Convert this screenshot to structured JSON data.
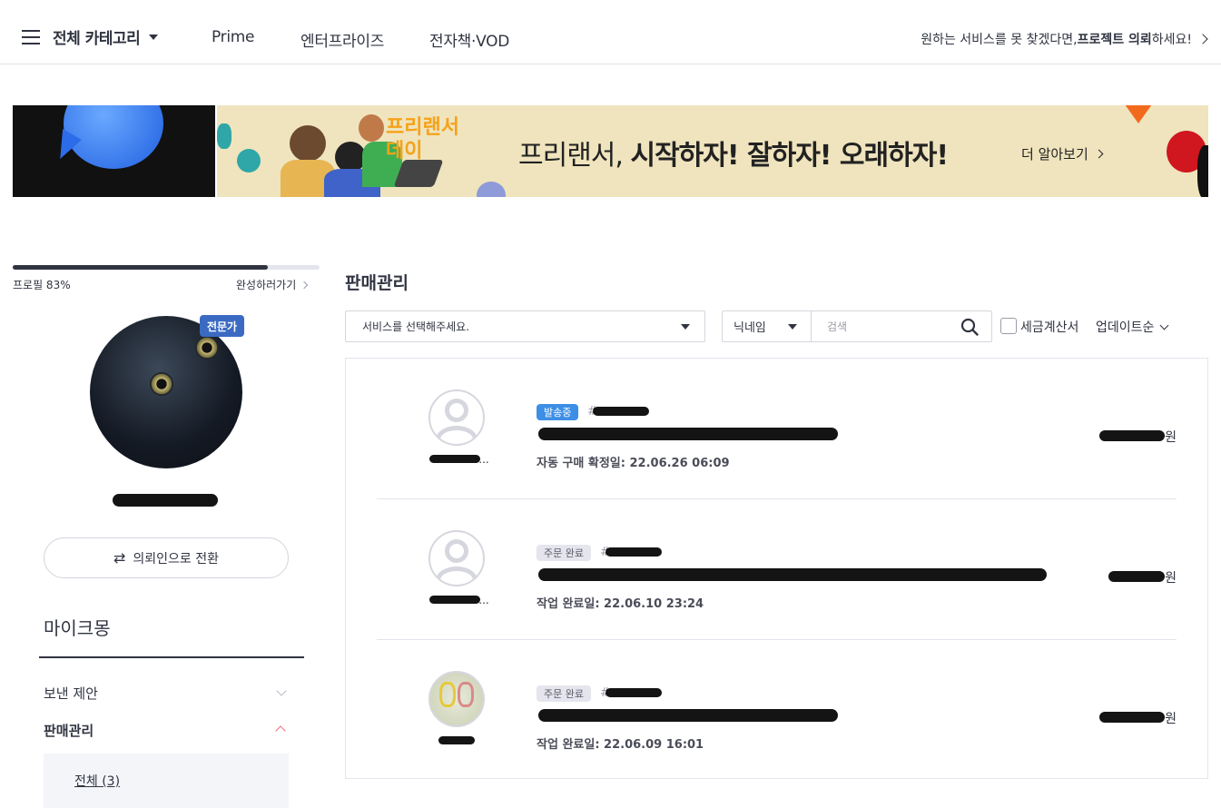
{
  "nav": {
    "category": "전체 카테고리",
    "links": [
      "Prime",
      "엔터프라이즈",
      "전자책·VOD"
    ],
    "right_prefix": "원하는 서비스를 못 찾겠다면, ",
    "right_bold": "프로젝트 의뢰",
    "right_suffix": "하세요!"
  },
  "banner": {
    "badge_title": "프리랜서 데이",
    "copy_prefix": "프리랜서, ",
    "copy_bold": "시작하자! 잘하자! 오래하자!",
    "more": "더 알아보기"
  },
  "profile": {
    "progress_label": "프로필 83%",
    "progress": 0.83,
    "complete_link": "완성하러가기",
    "expert_badge": "전문가",
    "nickname": "",
    "switch_button": "의뢰인으로 전환"
  },
  "sidebar": {
    "section_title": "마이크몽",
    "items": [
      {
        "label": "보낸 제안",
        "expanded": false
      },
      {
        "label": "판매관리",
        "expanded": true
      }
    ],
    "sub_items": [
      "전체 (3)"
    ]
  },
  "main": {
    "title": "판매관리",
    "service_select": "서비스를 선택해주세요.",
    "search_type": "닉네임",
    "search_placeholder": "검색",
    "tax_label": "세금계산서",
    "sort_label": "업데이트순"
  },
  "orders": [
    {
      "status": "발송중",
      "status_type": "ship",
      "order_no": "#",
      "title": "",
      "date": "자동 구매 확정일: 22.06.26 06:09",
      "price_suffix": "원",
      "buyer": "..."
    },
    {
      "status": "주문 완료",
      "status_type": "done",
      "order_no": "#",
      "title": "",
      "date": "작업 완료일: 22.06.10 23:24",
      "price_suffix": "원",
      "buyer": "..."
    },
    {
      "status": "주문 완료",
      "status_type": "done",
      "order_no": "#",
      "title": "",
      "date": "작업 완료일: 22.06.09 16:01",
      "price_suffix": "원",
      "buyer": ""
    }
  ],
  "colors": {
    "text": "#303441",
    "border": "#e4e5ed",
    "ship_badge": "#3d8fe6",
    "expert_badge": "#3a6ac2",
    "banner_bg": "#efe4bd",
    "banner_accent": "#f6a21a"
  }
}
